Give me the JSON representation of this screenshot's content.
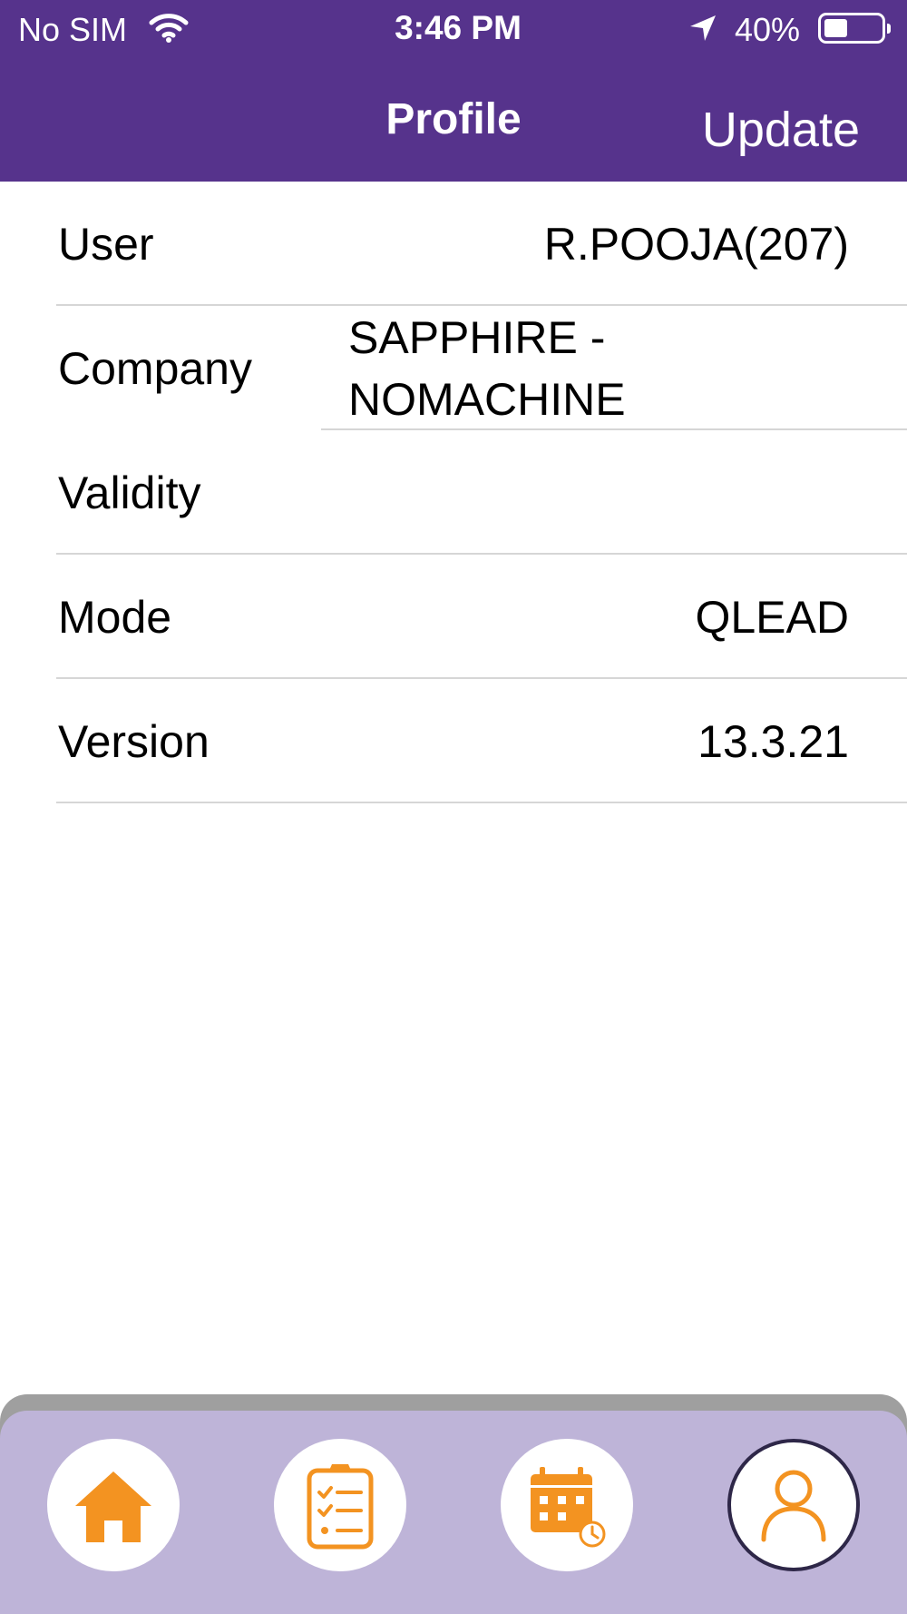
{
  "status_bar": {
    "carrier": "No SIM",
    "time": "3:46 PM",
    "battery_percent": "40%",
    "battery_level": 0.4,
    "icons": [
      "wifi-icon",
      "location-arrow-icon",
      "battery-icon"
    ]
  },
  "nav": {
    "title": "Profile",
    "update_label": "Update"
  },
  "profile": {
    "rows": [
      {
        "label": "User",
        "value": "R.POOJA(207)"
      },
      {
        "label": "Company",
        "value": "SAPPHIRE - NOMACHINE"
      },
      {
        "label": "Validity",
        "value": ""
      },
      {
        "label": "Mode",
        "value": "QLEAD"
      },
      {
        "label": "Version",
        "value": "13.3.21"
      }
    ]
  },
  "tab_bar": {
    "tabs": [
      {
        "icon": "home-icon",
        "active": false
      },
      {
        "icon": "clipboard-checklist-icon",
        "active": false
      },
      {
        "icon": "calendar-clock-icon",
        "active": false
      },
      {
        "icon": "user-profile-icon",
        "active": true
      }
    ]
  },
  "colors": {
    "header": "#56338c",
    "tab_bar": "#beb4d8",
    "accent": "#f39321",
    "active_ring": "#2e2748"
  }
}
